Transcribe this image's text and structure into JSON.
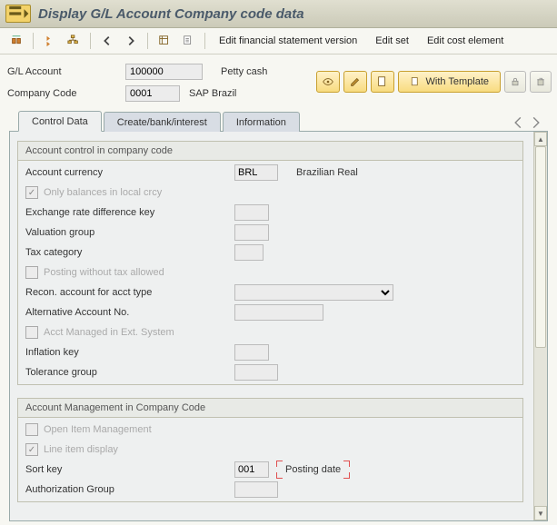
{
  "title": "Display G/L Account Company code data",
  "toolbar_links": {
    "edit_fsv": "Edit financial statement version",
    "edit_set": "Edit set",
    "edit_cost": "Edit cost element"
  },
  "header": {
    "gl_label": "G/L Account",
    "gl_value": "100000",
    "gl_desc": "Petty cash",
    "cc_label": "Company Code",
    "cc_value": "0001",
    "cc_desc": "SAP Brazil",
    "with_template": "With Template"
  },
  "tabs": {
    "t1": "Control Data",
    "t2": "Create/bank/interest",
    "t3": "Information"
  },
  "group1": {
    "title": "Account control in company code",
    "currency_lbl": "Account currency",
    "currency_val": "BRL",
    "currency_desc": "Brazilian Real",
    "only_bal": "Only balances in local crcy",
    "ex_rate": "Exchange rate difference key",
    "val_group": "Valuation group",
    "tax_cat": "Tax category",
    "post_no_tax": "Posting without tax allowed",
    "recon": "Recon. account for acct type",
    "alt_acct": "Alternative Account No.",
    "ext_sys": "Acct Managed in Ext. System",
    "infl_key": "Inflation key",
    "tol_group": "Tolerance group"
  },
  "group2": {
    "title": "Account Management in Company Code",
    "open_item": "Open Item Management",
    "line_item": "Line item display",
    "sort_key_lbl": "Sort key",
    "sort_key_val": "001",
    "sort_key_desc": "Posting date",
    "auth_group": "Authorization Group"
  }
}
